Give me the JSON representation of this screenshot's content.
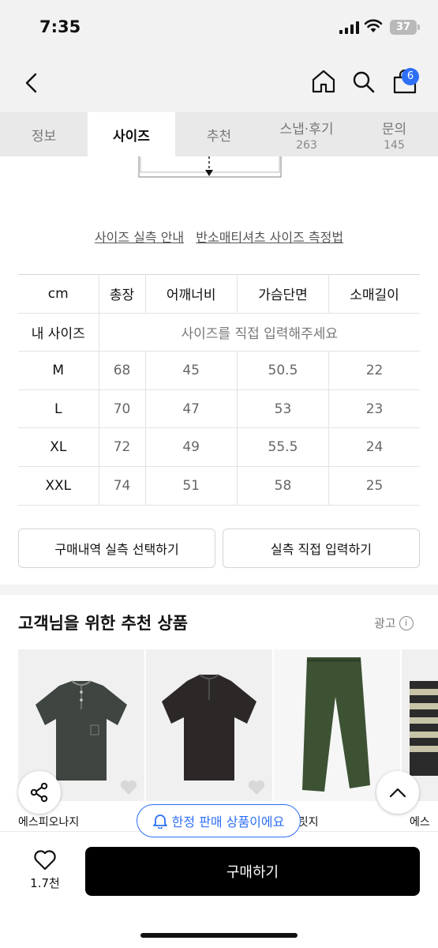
{
  "status": {
    "time": "7:35",
    "battery": "37"
  },
  "nav": {
    "cart_count": "6"
  },
  "tabs": [
    {
      "label": "정보",
      "count": ""
    },
    {
      "label": "사이즈",
      "count": ""
    },
    {
      "label": "추천",
      "count": ""
    },
    {
      "label": "스냅·후기",
      "count": "263"
    },
    {
      "label": "문의",
      "count": "145"
    }
  ],
  "links": {
    "guide": "사이즈 실측 안내",
    "method": "반소매티셔츠 사이즈 측정법"
  },
  "size_table": {
    "headers": [
      "cm",
      "총장",
      "어깨너비",
      "가슴단면",
      "소매길이"
    ],
    "my_size_label": "내 사이즈",
    "my_size_placeholder": "사이즈를 직접 입력해주세요",
    "rows": [
      [
        "M",
        "68",
        "45",
        "50.5",
        "22"
      ],
      [
        "L",
        "70",
        "47",
        "53",
        "23"
      ],
      [
        "XL",
        "72",
        "49",
        "55.5",
        "24"
      ],
      [
        "XXL",
        "74",
        "51",
        "58",
        "25"
      ]
    ]
  },
  "buttons": {
    "select_history": "구매내역 실측 선택하기",
    "direct_input": "실측 직접 입력하기"
  },
  "recommend": {
    "title": "고객님을 위한 추천 상품",
    "ad_label": "광고",
    "products": [
      {
        "name": "에스피오나지"
      },
      {
        "name": ""
      },
      {
        "name": "폼브릿지"
      },
      {
        "name": "에스피"
      }
    ]
  },
  "limited_chip": "한정 판매 상품이에요",
  "bottom": {
    "like_count": "1.7천",
    "buy_label": "구매하기"
  },
  "colors": {
    "accent": "#2d6ff5",
    "buy_bg": "#000000"
  }
}
